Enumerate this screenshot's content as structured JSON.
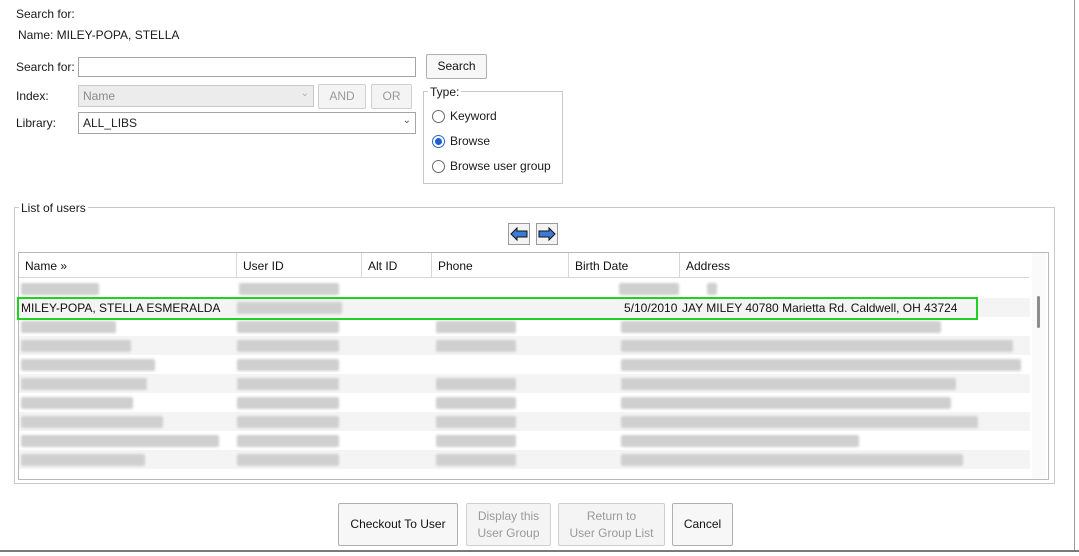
{
  "header": {
    "search_for_caption": "Search for:",
    "name_line": "Name: MILEY-POPA, STELLA"
  },
  "search": {
    "label": "Search for:",
    "value": "",
    "button": "Search"
  },
  "index": {
    "label": "Index:",
    "selected": "Name",
    "and_button": "AND",
    "or_button": "OR"
  },
  "library": {
    "label": "Library:",
    "selected": "ALL_LIBS"
  },
  "type": {
    "legend": "Type:",
    "options": [
      {
        "label": "Keyword",
        "selected": false
      },
      {
        "label": "Browse",
        "selected": true
      },
      {
        "label": "Browse user group",
        "selected": false
      }
    ]
  },
  "users": {
    "legend": "List of users",
    "columns": [
      "Name »",
      "User ID",
      "Alt ID",
      "Phone",
      "Birth Date",
      "Address"
    ],
    "selected_row": {
      "name": "MILEY-POPA, STELLA ESMERALDA",
      "user_id": "",
      "alt_id": "",
      "phone": "",
      "birth_date": "5/10/2010",
      "address": "JAY MILEY 40780 Marietta Rd. Caldwell, OH 43724"
    }
  },
  "footer": {
    "checkout": "Checkout To User",
    "display_group_line1": "Display this",
    "display_group_line2": "User Group",
    "return_line1": "Return to",
    "return_line2": "User Group List",
    "cancel": "Cancel"
  },
  "colors": {
    "selection_outline": "#1fd21f",
    "radio_accent": "#1c5fd1",
    "arrow_fill": "#3a7bd5"
  }
}
